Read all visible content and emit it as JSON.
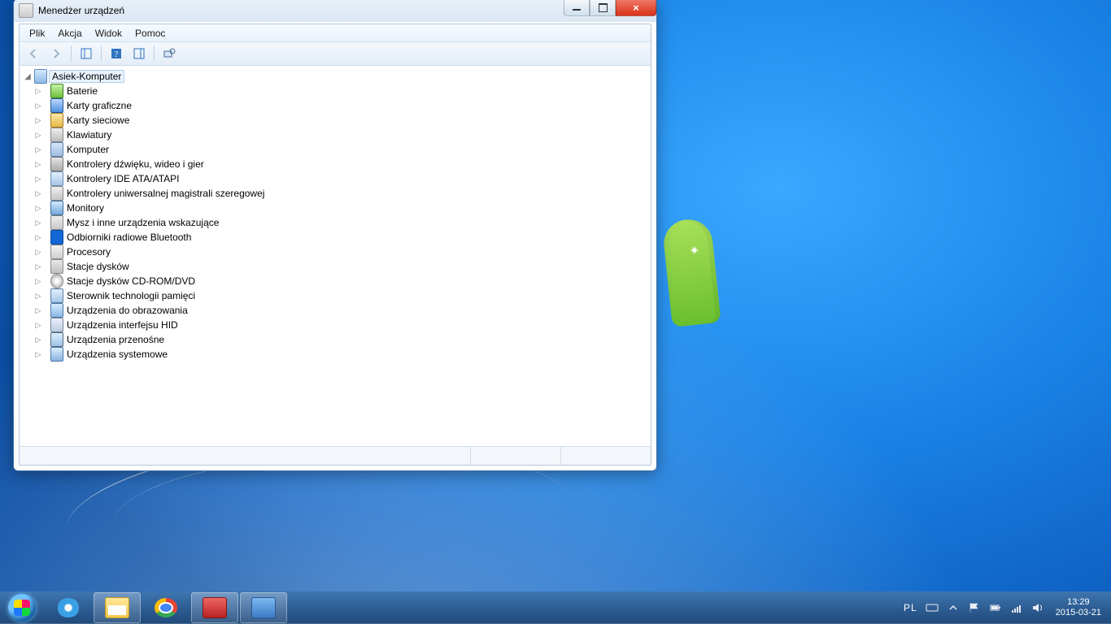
{
  "window": {
    "title": "Menedżer urządzeń"
  },
  "menu": {
    "items": [
      "Plik",
      "Akcja",
      "Widok",
      "Pomoc"
    ]
  },
  "tree": {
    "root": "Asiek-Komputer",
    "nodes": [
      {
        "icon": "battery",
        "label": "Baterie"
      },
      {
        "icon": "display",
        "label": "Karty graficzne"
      },
      {
        "icon": "net",
        "label": "Karty sieciowe"
      },
      {
        "icon": "kbd",
        "label": "Klawiatury"
      },
      {
        "icon": "pc",
        "label": "Komputer"
      },
      {
        "icon": "audio",
        "label": "Kontrolery dźwięku, wideo i gier"
      },
      {
        "icon": "ide",
        "label": "Kontrolery IDE ATA/ATAPI"
      },
      {
        "icon": "usb",
        "label": "Kontrolery uniwersalnej magistrali szeregowej"
      },
      {
        "icon": "mon",
        "label": "Monitory"
      },
      {
        "icon": "mouse",
        "label": "Mysz i inne urządzenia wskazujące"
      },
      {
        "icon": "bt",
        "label": "Odbiorniki radiowe Bluetooth"
      },
      {
        "icon": "cpu",
        "label": "Procesory"
      },
      {
        "icon": "hdd",
        "label": "Stacje dysków"
      },
      {
        "icon": "cd",
        "label": "Stacje dysków CD-ROM/DVD"
      },
      {
        "icon": "mem",
        "label": "Sterownik technologii pamięci"
      },
      {
        "icon": "cam",
        "label": "Urządzenia do obrazowania"
      },
      {
        "icon": "hid",
        "label": "Urządzenia interfejsu HID"
      },
      {
        "icon": "port",
        "label": "Urządzenia przenośne"
      },
      {
        "icon": "sys",
        "label": "Urządzenia systemowe"
      }
    ]
  },
  "tray": {
    "lang": "PL",
    "time": "13:29",
    "date": "2015-03-21"
  }
}
